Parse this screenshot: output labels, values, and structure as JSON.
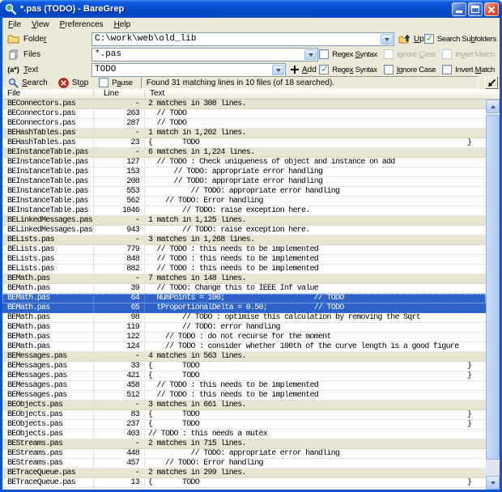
{
  "window": {
    "title": "*.pas (TODO) - BareGrep"
  },
  "menu": {
    "items": [
      {
        "pre": "",
        "key": "F",
        "post": "ile"
      },
      {
        "pre": "",
        "key": "V",
        "post": "iew"
      },
      {
        "pre": "",
        "key": "P",
        "post": "references"
      },
      {
        "pre": "",
        "key": "H",
        "post": "elp"
      }
    ]
  },
  "controls": {
    "folder": {
      "label_pre": "Folde",
      "label_key": "r",
      "label_post": "",
      "value": "C:\\work\\web\\old_lib"
    },
    "files": {
      "label_pre": "Files",
      "label_key": "",
      "label_post": "",
      "value": "*.pas"
    },
    "text": {
      "label_pre": "",
      "label_key": "T",
      "label_post": "ext",
      "value": "TODO",
      "icon_text": "(a*)"
    },
    "up_button": {
      "pre": "",
      "key": "U",
      "post": "p"
    },
    "add_button": {
      "pre": "",
      "key": "A",
      "post": "dd"
    },
    "search_subfolders": {
      "pre": "Search Su",
      "key": "b",
      "post": "folders",
      "checked": true,
      "disabled": false
    },
    "files_regex": {
      "pre": "Regex ",
      "key": "S",
      "post": "yntax",
      "checked": false,
      "disabled": false
    },
    "files_ignore": {
      "pre": "Ignore ",
      "key": "C",
      "post": "ase",
      "checked": false,
      "disabled": true
    },
    "files_invert": {
      "pre": "In",
      "key": "v",
      "post": "ert Match",
      "checked": false,
      "disabled": true
    },
    "text_regex": {
      "pre": "Rege",
      "key": "x",
      "post": " Syntax",
      "checked": true,
      "disabled": false
    },
    "text_ignore": {
      "pre": "",
      "key": "I",
      "post": "gnore Case",
      "checked": false,
      "disabled": false
    },
    "text_invert": {
      "pre": "Invert ",
      "key": "M",
      "post": "atch",
      "checked": false,
      "disabled": false
    }
  },
  "toolbar": {
    "search": {
      "pre": "",
      "key": "S",
      "post": "earch"
    },
    "stop": {
      "pre": "St",
      "key": "o",
      "post": "p"
    },
    "pause": {
      "pre": "P",
      "key": "a",
      "post": "use",
      "checked": false,
      "disabled": false
    },
    "status": "Found 31 matching lines in 10 files (of 18 searched)."
  },
  "colors": {
    "titlebar": "#0b4fd0",
    "selection": "#2f63c9",
    "summary_row": "#e9e5d3",
    "check_green": "#21a121",
    "stop_red": "#cf2a1b"
  },
  "grid": {
    "columns": [
      "File",
      "Line",
      "Text"
    ],
    "rows": [
      {
        "file": "BEConnectors.pas",
        "line": "-",
        "text": "2 matches in 308 lines.",
        "type": "summary"
      },
      {
        "file": "BEConnectors.pas",
        "line": "263",
        "text": "  // TODO"
      },
      {
        "file": "BEConnectors.pas",
        "line": "287",
        "text": "  // TODO"
      },
      {
        "file": "BEHashTables.pas",
        "line": "-",
        "text": "1 match in 1,202 lines.",
        "type": "summary"
      },
      {
        "file": "BEHashTables.pas",
        "line": "23",
        "text": "{       TODO                                                               }"
      },
      {
        "file": "BEInstanceTable.pas",
        "line": "-",
        "text": "6 matches in 1,224 lines.",
        "type": "summary"
      },
      {
        "file": "BEInstanceTable.pas",
        "line": "127",
        "text": "  // TODO : Check uniqueness of object and instance on add"
      },
      {
        "file": "BEInstanceTable.pas",
        "line": "153",
        "text": "      // TODO: appropriate error handling"
      },
      {
        "file": "BEInstanceTable.pas",
        "line": "208",
        "text": "      // TODO: appropriate error handling"
      },
      {
        "file": "BEInstanceTable.pas",
        "line": "553",
        "text": "          // TODO: appropriate error handling"
      },
      {
        "file": "BEInstanceTable.pas",
        "line": "562",
        "text": "    // TODO: Error handling"
      },
      {
        "file": "BEInstanceTable.pas",
        "line": "1046",
        "text": "        // TODO: raise exception here."
      },
      {
        "file": "BELinkedMessages.pas",
        "line": "-",
        "text": "1 match in 1,125 lines.",
        "type": "summary"
      },
      {
        "file": "BELinkedMessages.pas",
        "line": "943",
        "text": "        // TODO: raise exception here."
      },
      {
        "file": "BELists.pas",
        "line": "-",
        "text": "3 matches in 1,268 lines.",
        "type": "summary"
      },
      {
        "file": "BELists.pas",
        "line": "779",
        "text": "  // TODO : this needs to be implemented"
      },
      {
        "file": "BELists.pas",
        "line": "848",
        "text": "  // TODO : this needs to be implemented"
      },
      {
        "file": "BELists.pas",
        "line": "882",
        "text": "  // TODO : this needs to be implemented"
      },
      {
        "file": "BEMath.pas",
        "line": "-",
        "text": "7 matches in 148 lines.",
        "type": "summary"
      },
      {
        "file": "BEMath.pas",
        "line": "39",
        "text": "  // TODO: Change this to IEEE Inf value"
      },
      {
        "file": "BEMath.pas",
        "line": "64",
        "text": "  NumPoints = 100;                     // TODO",
        "state": "sel focus"
      },
      {
        "file": "BEMath.pas",
        "line": "65",
        "text": "  tProportionalDelta = 0.50;           // TODO",
        "state": "sel"
      },
      {
        "file": "BEMath.pas",
        "line": "98",
        "text": "        // TODO : optimise this calculation by removing the Sqrt"
      },
      {
        "file": "BEMath.pas",
        "line": "119",
        "text": "        // TODO: error handling"
      },
      {
        "file": "BEMath.pas",
        "line": "122",
        "text": "    // TODO : do not recurse for the moment"
      },
      {
        "file": "BEMath.pas",
        "line": "124",
        "text": "    // TODO : consider whether 100th of the curve length is a good figure"
      },
      {
        "file": "BEMessages.pas",
        "line": "-",
        "text": "4 matches in 563 lines.",
        "type": "summary"
      },
      {
        "file": "BEMessages.pas",
        "line": "33",
        "text": "{       TODO                                                               }"
      },
      {
        "file": "BEMessages.pas",
        "line": "421",
        "text": "{       TODO                                                               }"
      },
      {
        "file": "BEMessages.pas",
        "line": "458",
        "text": "  // TODO : this needs to be implemented"
      },
      {
        "file": "BEMessages.pas",
        "line": "512",
        "text": "  // TODO : this needs to be implemented"
      },
      {
        "file": "BEObjects.pas",
        "line": "-",
        "text": "3 matches in 661 lines.",
        "type": "summary"
      },
      {
        "file": "BEObjects.pas",
        "line": "83",
        "text": "{       TODO                                                               }"
      },
      {
        "file": "BEObjects.pas",
        "line": "237",
        "text": "{       TODO                                                               }"
      },
      {
        "file": "BEObjects.pas",
        "line": "403",
        "text": "// TODO : this needs a mutex"
      },
      {
        "file": "BEStreams.pas",
        "line": "-",
        "text": "2 matches in 715 lines.",
        "type": "summary"
      },
      {
        "file": "BEStreams.pas",
        "line": "448",
        "text": "          // TODO: appropriate error handling"
      },
      {
        "file": "BEStreams.pas",
        "line": "457",
        "text": "    // TODO: Error handling"
      },
      {
        "file": "BETraceQueue.pas",
        "line": "-",
        "text": "2 matches in 299 lines.",
        "type": "summary"
      },
      {
        "file": "BETraceQueue.pas",
        "line": "13",
        "text": "{       TODO                                                               }"
      }
    ]
  }
}
